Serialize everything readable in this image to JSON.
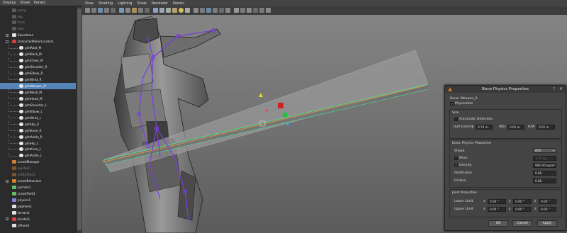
{
  "outliner": {
    "menu": [
      "Display",
      "Show",
      "Panels"
    ],
    "items": [
      {
        "label": "persp",
        "indent": 2,
        "state": "dim",
        "icon": "camera-icon",
        "exp": ""
      },
      {
        "label": "top",
        "indent": 2,
        "state": "dim",
        "icon": "camera-icon",
        "exp": ""
      },
      {
        "label": "front",
        "indent": 2,
        "state": "dim",
        "icon": "camera-icon",
        "exp": ""
      },
      {
        "label": "side",
        "indent": 2,
        "state": "dim",
        "icon": "camera-icon",
        "exp": ""
      },
      {
        "label": "Swordman",
        "indent": 2,
        "state": "normal",
        "icon": "mesh-icon",
        "exp": "+"
      },
      {
        "label": "characterMakerLocator1",
        "indent": 2,
        "state": "normal",
        "icon": "locator-icon",
        "exp": "-"
      },
      {
        "label": "glmRoot_M",
        "indent": 3,
        "state": "normal",
        "icon": "joint-icon",
        "exp": ""
      },
      {
        "label": "glmBack_M",
        "indent": 3,
        "state": "normal",
        "icon": "joint-icon",
        "exp": ""
      },
      {
        "label": "glmChest_M",
        "indent": 3,
        "state": "normal",
        "icon": "joint-icon",
        "exp": ""
      },
      {
        "label": "glmShoulder_R",
        "indent": 3,
        "state": "normal",
        "icon": "joint-icon",
        "exp": ""
      },
      {
        "label": "glmElbow_R",
        "indent": 3,
        "state": "normal",
        "icon": "joint-icon",
        "exp": ""
      },
      {
        "label": "glmWrist_R",
        "indent": 3,
        "state": "normal",
        "icon": "joint-icon",
        "exp": ""
      },
      {
        "label": "glmWeapon_R",
        "indent": 3,
        "state": "selected",
        "icon": "joint-icon",
        "exp": ""
      },
      {
        "label": "glmNeck_M",
        "indent": 3,
        "state": "normal",
        "icon": "joint-icon",
        "exp": ""
      },
      {
        "label": "glmHead_M",
        "indent": 3,
        "state": "normal",
        "icon": "joint-icon",
        "exp": ""
      },
      {
        "label": "glmShoulder_L",
        "indent": 3,
        "state": "normal",
        "icon": "joint-icon",
        "exp": ""
      },
      {
        "label": "glmElbow_L",
        "indent": 3,
        "state": "normal",
        "icon": "joint-icon",
        "exp": ""
      },
      {
        "label": "glmWrist_L",
        "indent": 3,
        "state": "normal",
        "icon": "joint-icon",
        "exp": ""
      },
      {
        "label": "glmHip_R",
        "indent": 3,
        "state": "normal",
        "icon": "joint-icon",
        "exp": ""
      },
      {
        "label": "glmKnee_R",
        "indent": 3,
        "state": "normal",
        "icon": "joint-icon",
        "exp": ""
      },
      {
        "label": "glmAnkle_R",
        "indent": 3,
        "state": "normal",
        "icon": "joint-icon",
        "exp": ""
      },
      {
        "label": "glmHip_L",
        "indent": 3,
        "state": "normal",
        "icon": "joint-icon",
        "exp": ""
      },
      {
        "label": "glmKnee_L",
        "indent": 3,
        "state": "normal",
        "icon": "joint-icon",
        "exp": ""
      },
      {
        "label": "glmAnkle_L",
        "indent": 3,
        "state": "normal",
        "icon": "joint-icon",
        "exp": ""
      },
      {
        "label": "crowdManager",
        "indent": 2,
        "state": "normal",
        "icon": "crowd-icon",
        "exp": ""
      },
      {
        "label": "popTool1",
        "indent": 2,
        "state": "dim",
        "icon": "crowd-icon",
        "exp": ""
      },
      {
        "label": "entityType1",
        "indent": 2,
        "state": "dim",
        "icon": "crowd-icon",
        "exp": ""
      },
      {
        "label": "crowdBehaviors",
        "indent": 2,
        "state": "normal",
        "icon": "crowd-icon",
        "exp": "+"
      },
      {
        "label": "particle1",
        "indent": 2,
        "state": "normal",
        "icon": "particle-icon",
        "exp": ""
      },
      {
        "label": "crowdField1",
        "indent": 2,
        "state": "normal",
        "icon": "particle-icon",
        "exp": ""
      },
      {
        "label": "physics1",
        "indent": 2,
        "state": "normal",
        "icon": "physics-icon",
        "exp": ""
      },
      {
        "label": "pSphere1",
        "indent": 2,
        "state": "normal",
        "icon": "mesh-icon",
        "exp": ""
      },
      {
        "label": "terrain1",
        "indent": 2,
        "state": "normal",
        "icon": "mesh-icon",
        "exp": ""
      },
      {
        "label": "locator1",
        "indent": 2,
        "state": "normal",
        "icon": "locator-icon",
        "exp": "+"
      },
      {
        "label": "pPlane1",
        "indent": 2,
        "state": "normal",
        "icon": "mesh-icon",
        "exp": ""
      }
    ]
  },
  "viewport": {
    "menu": [
      "View",
      "Shading",
      "Lighting",
      "Show",
      "Renderer",
      "Panels"
    ]
  },
  "dialog": {
    "title": "Bone Physics Properties",
    "help": "?",
    "close": "×",
    "bone_label": "Bone: Weapon_R",
    "physicalize_label": "Physicalize",
    "physicalize_checked": "✓",
    "size": {
      "heading": "Size",
      "auto_label": "Automatic Detection",
      "half_label": "Half Extents",
      "l_label": "L",
      "l_value": "0.70 m",
      "w_label": "W/H",
      "w_value": "0.05 m",
      "h_label": "H/W",
      "h_value": "0.01 m"
    },
    "basic": {
      "heading": "Basic Physics Properties",
      "shape_label": "Shape",
      "shape_value": "BOX",
      "mass_label": "Mass",
      "mass_value": "1.75 kg",
      "density_label": "Density",
      "density_checked": "✓",
      "density_value": "985.00 kg/m³",
      "restitution_label": "Restitution",
      "restitution_value": "0.80",
      "friction_label": "Friction",
      "friction_value": "0.80"
    },
    "joint": {
      "heading": "Joint Properties",
      "lower_label": "Lower Limit",
      "upper_label": "Upper Limit",
      "x_label": "x",
      "y_label": "y",
      "z_label": "z",
      "lower_x": "0.00 °",
      "lower_y": "0.00 °",
      "lower_z": "0.00 °",
      "upper_x": "0.00 °",
      "upper_y": "0.00 °",
      "upper_z": "0.00 °"
    },
    "buttons": {
      "ok": "OK",
      "cancel": "Cancel",
      "apply": "Apply"
    }
  }
}
